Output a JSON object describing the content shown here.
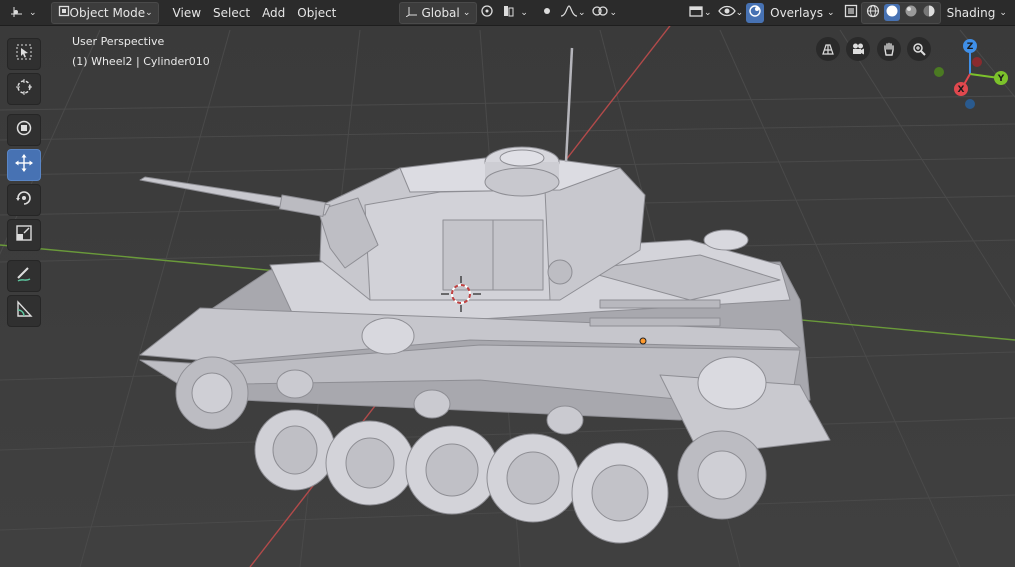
{
  "header": {
    "mode": "Object Mode",
    "menus": [
      "View",
      "Select",
      "Add",
      "Object"
    ],
    "transform_orientation": "Global",
    "overlays_label": "Overlays",
    "shading_label": "Shading"
  },
  "viewport": {
    "view_name": "User Perspective",
    "object_info": "(1) Wheel2 | Cylinder010"
  },
  "gizmo": {
    "x_label": "X",
    "y_label": "Y",
    "z_label": "Z"
  },
  "colors": {
    "active_tool": "#4772b3",
    "x_axis": "#e0484e",
    "y_axis": "#7cc22b",
    "z_axis": "#3f8fe8"
  },
  "icons": [
    "editor-type-icon",
    "object-mode-icon",
    "pivot-icon",
    "snap-icon",
    "proportional-icon",
    "visibility-icon",
    "overlays-icon",
    "xray-icon",
    "shading-wire-icon",
    "shading-solid-icon",
    "shading-material-icon",
    "shading-rendered-icon",
    "select-box-icon",
    "cursor-icon",
    "move-icon",
    "rotate-icon",
    "scale-icon",
    "transform-icon",
    "annotate-icon",
    "measure-icon",
    "grid-view-icon",
    "camera-icon",
    "hand-icon",
    "zoom-icon"
  ]
}
